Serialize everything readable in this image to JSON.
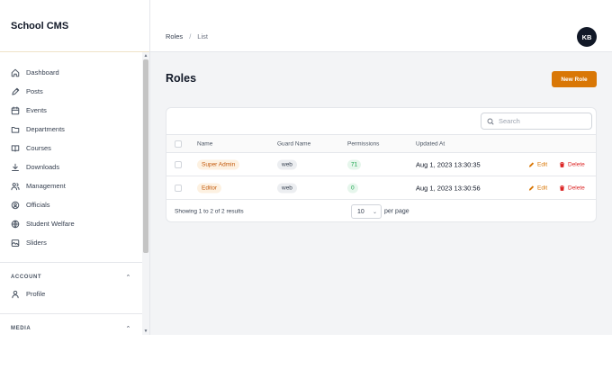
{
  "sidebar": {
    "brand": "School CMS",
    "items": [
      {
        "label": "Dashboard",
        "icon": "home-icon"
      },
      {
        "label": "Posts",
        "icon": "pencil-icon"
      },
      {
        "label": "Events",
        "icon": "calendar-icon"
      },
      {
        "label": "Departments",
        "icon": "folder-icon"
      },
      {
        "label": "Courses",
        "icon": "book-icon"
      },
      {
        "label": "Downloads",
        "icon": "download-icon"
      },
      {
        "label": "Management",
        "icon": "users-icon"
      },
      {
        "label": "Officials",
        "icon": "badge-icon"
      },
      {
        "label": "Student Welfare",
        "icon": "globe-icon"
      },
      {
        "label": "Sliders",
        "icon": "image-icon"
      }
    ],
    "account": {
      "heading": "ACCOUNT",
      "items": [
        {
          "label": "Profile",
          "icon": "user-icon"
        }
      ]
    },
    "media": {
      "heading": "MEDIA"
    }
  },
  "topbar": {
    "breadcrumb": [
      "Roles",
      "List"
    ],
    "avatar_initials": "KB"
  },
  "main": {
    "title": "Roles",
    "new_button": "New Role",
    "search_placeholder": "Search",
    "columns": [
      "Name",
      "Guard Name",
      "Permissions",
      "Updated At"
    ],
    "rows": [
      {
        "name": "Super Admin",
        "guard": "web",
        "permissions": "71",
        "updated": "Aug 1, 2023 13:30:35"
      },
      {
        "name": "Editor",
        "guard": "web",
        "permissions": "0",
        "updated": "Aug 1, 2023 13:30:56"
      }
    ],
    "actions": {
      "edit": "Edit",
      "delete": "Delete"
    },
    "footer": {
      "summary": "Showing 1 to 2 of 2 results",
      "per_page_value": "10",
      "per_page_label": "per page"
    }
  },
  "colors": {
    "accent": "#d97706",
    "danger": "#dc2626",
    "success": "#16a34a"
  }
}
